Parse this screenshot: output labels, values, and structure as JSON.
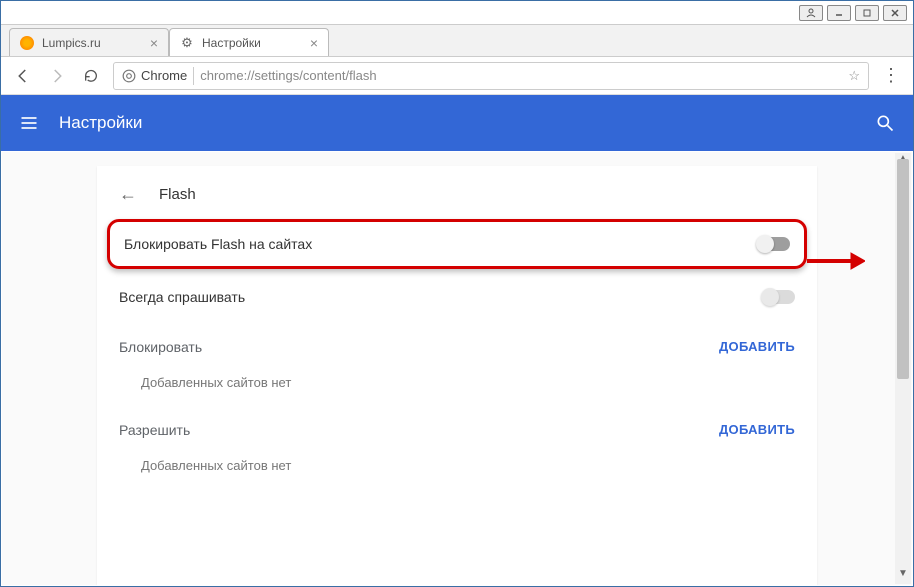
{
  "window": {
    "tabs": [
      {
        "title": "Lumpics.ru",
        "icon": "lumpics"
      },
      {
        "title": "Настройки",
        "icon": "gear"
      }
    ]
  },
  "address_bar": {
    "origin_label": "Chrome",
    "url": "chrome://settings/content/flash"
  },
  "settings_header": {
    "title": "Настройки"
  },
  "page": {
    "section_title": "Flash",
    "rows": {
      "block_flash": {
        "label": "Блокировать Flash на сайтах",
        "state": "off"
      },
      "always_ask": {
        "label": "Всегда спрашивать",
        "state": "off_disabled"
      }
    },
    "lists": {
      "block": {
        "header": "Блокировать",
        "add_label": "ДОБАВИТЬ",
        "empty": "Добавленных сайтов нет"
      },
      "allow": {
        "header": "Разрешить",
        "add_label": "ДОБАВИТЬ",
        "empty": "Добавленных сайтов нет"
      }
    }
  }
}
